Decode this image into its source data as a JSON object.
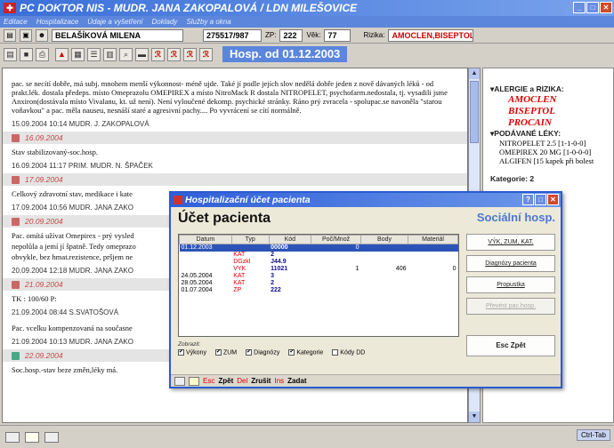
{
  "window": {
    "title": "PC DOKTOR NIS   -  MUDR.  JANA ZAKOPALOVÁ / LDN MILEŠOVICE"
  },
  "menu": [
    "Editace",
    "Hospitalizace",
    "Údaje a vyšetření",
    "Doklady",
    "Služby a okna"
  ],
  "patient": {
    "name": "BELAŠÍKOVÁ MILENA",
    "id": "275517/987",
    "zp_label": "ZP:",
    "zp": "222",
    "vek_label": "Věk:",
    "vek": "77",
    "rizika_label": "Rizika:",
    "rizika": "AMOCLEN,BISEPTOL,"
  },
  "banner": "Hosp. od  01.12.2003",
  "notes": {
    "first_text": "pac. se necítí dobře, má subj. mnohem menší výkonnost- méně ujde. Také jí podle jejích slov nedělá dobře jeden z nově dávaných léků - od prakt.lék. dostala předeps. místo Omeprazolu  OMEPIREX a místo NitroMack R dostala NITROPELET, psychofarm.nedostala, tj. vysadili jsme Anxiron(dostávala místo Vivalanu, kt. už není). Není vyloučené dekomp. psychické stránky. Ráno prý zvracela - spolupac.se navoněla \"starou voňavkou\" a pac. měla nauseu, nesnáší staré a agresivní pachy.... Po vyvrácení se cítí normálně.",
    "sig1": "15.09.2004 10:14 MUDR.  J. ZAKOPALOVÁ",
    "date2": "16.09.2004",
    "text2": "Stav stabilizovaný-soc.hosp.",
    "sig2": "16.09.2004 11:17 PRIM. MUDR.  N. ŠPAČEK",
    "date3": "17.09.2004",
    "text3": "Celkový zdravotní stav, medikace i kate",
    "sig3": "17.09.2004 10:56 MUDR.  JANA  ZAKO",
    "date4": "20.09.2004",
    "text4": "Pac. omítá užívat Omepirex - prý vysled",
    "text4b": "nepolůla a jemí jí špatně. Tedy omeprazo",
    "text4c": "obvykle, bez hmat.rezistence, pršjem ne",
    "sig4": "20.09.2004 12:18 MUDR.  JANA  ZAKO",
    "date5": "21.09.2004",
    "text5": "TK : 100/60 P:",
    "sig5": "21.09.2004 08:44 S.SVATOŠOVÁ",
    "text6": "Pac. vcelku kompenzovaná na současne",
    "sig6": "21.09.2004 10:13 MUDR.  JANA  ZAKO",
    "date7": "22.09.2004",
    "text7": "Soc.hosp.-stav beze změn,léky má."
  },
  "right_panel": {
    "alergie_head": "ALERGIE a RIZIKA:",
    "alergie": [
      "AMOCLEN",
      "BISEPTOL",
      "PROCAIN"
    ],
    "leky_head": "PODÁVANÉ LÉKY:",
    "leky": [
      "NITROPELET 2.5  [1-1-0-0]",
      "OMEPIREX 20 MG  [1-0-0-0]",
      "ALGIFEN  [15 kapek při bolest"
    ],
    "kategorie": "Kategorie: 2"
  },
  "dialog": {
    "title": "Hospitalizační účet pacienta",
    "heading": "Účet pacienta",
    "subheading": "Sociální hosp.",
    "columns": [
      "Datum",
      "Typ",
      "Kód",
      "Poč/Množ",
      "Body",
      "Materiál"
    ],
    "rows": [
      {
        "datum": "01.12.2003",
        "typ": "",
        "kod": "00000",
        "poc": "0",
        "body": "",
        "mat": "",
        "sel": true
      },
      {
        "datum": "",
        "typ": "KAT",
        "kod": "2",
        "poc": "",
        "body": "",
        "mat": ""
      },
      {
        "datum": "",
        "typ": "DGzkl",
        "kod": "J44.9",
        "poc": "",
        "body": "",
        "mat": ""
      },
      {
        "datum": "",
        "typ": "VYK",
        "kod": "11021",
        "poc": "1",
        "body": "406",
        "mat": "0"
      },
      {
        "datum": "24.05.2004",
        "typ": "KAT",
        "kod": "3",
        "poc": "",
        "body": "",
        "mat": ""
      },
      {
        "datum": "28.05.2004",
        "typ": "KAT",
        "kod": "2",
        "poc": "",
        "body": "",
        "mat": ""
      },
      {
        "datum": "01.07.2004",
        "typ": "ZP",
        "kod": "222",
        "poc": "",
        "body": "",
        "mat": ""
      }
    ],
    "buttons": {
      "vyk": "VÝK, ZUM, KAT.",
      "diagnozy": "Diagnózy pacienta",
      "propustka": "Propustka",
      "preveden": "Převést pac.hosp.",
      "zpet": "Esc  Zpět"
    },
    "filters_label": "Zobrazit:",
    "filters": [
      {
        "label": "Výkony",
        "checked": true
      },
      {
        "label": "ZUM",
        "checked": true
      },
      {
        "label": "Diagnózy",
        "checked": true
      },
      {
        "label": "Kategorie",
        "checked": true
      },
      {
        "label": "Kódy DD",
        "checked": false
      }
    ],
    "footer": {
      "esc": "Esc",
      "zpet": "Zpět",
      "del": "Del",
      "zrusit": "Zrušit",
      "ins": "Ins",
      "zadat": "Zadat"
    }
  },
  "status": {
    "right": "Ctrl-Tab"
  }
}
